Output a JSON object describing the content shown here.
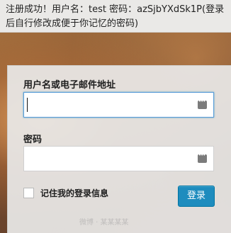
{
  "notice": {
    "text": "注册成功！用户名：test 密码：azSjbYXdSk1P(登录后自行修改成便于你记忆的密码)"
  },
  "login_form": {
    "username_label": "用户名或电子邮件地址",
    "username_value": "",
    "password_label": "密码",
    "password_value": "",
    "remember_label": "记住我的登录信息",
    "remember_checked": false,
    "submit_label": "登录"
  },
  "colors": {
    "accent": "#1e8cbe",
    "panel_bg": "#e8e7e5",
    "focus_border": "#5b9dd9"
  },
  "icons": {
    "field_key_icon": "keychain-icon"
  },
  "watermark": {
    "text": "微博 · 某某某某"
  }
}
